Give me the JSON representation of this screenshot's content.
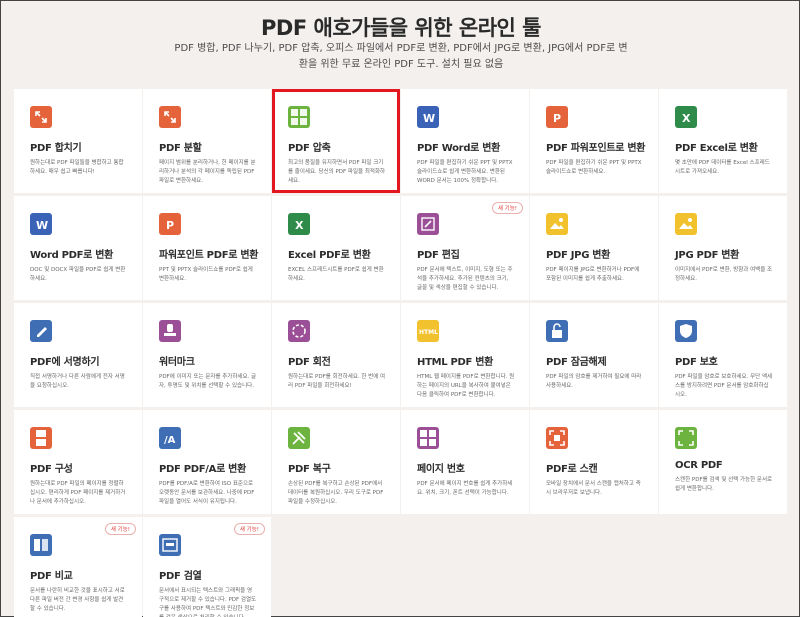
{
  "header": {
    "title": "PDF 애호가들을 위한 온라인 툴",
    "subtitle": "PDF 병합, PDF 나누기, PDF 압축, 오피스 파일에서 PDF로 변환, PDF에서 JPG로 변환, JPG에서 PDF로 변환을 위한 무료 온라인 PDF 도구. 설치 필요 없음"
  },
  "tools": [
    {
      "title": "PDF 합치기",
      "desc": "원하는대로 PDF 파일들을 병합하고 통합하세요. 매우 쉽고 빠릅니다!",
      "icon": "merge-icon",
      "color": "#e5633a",
      "badge": ""
    },
    {
      "title": "PDF 분할",
      "desc": "페이지 범위를 분리하거나, 한 페이지를 분리하거나 분석의 각 페이지를 독립된 PDF 파일로 변환하세요.",
      "icon": "split-icon",
      "color": "#e5633a",
      "badge": ""
    },
    {
      "title": "PDF 압축",
      "desc": "최고의 품질을 유지하면서 PDF 파일 크기를 줄이세요. 당신의 PDF 파일을 최적화하세요.",
      "icon": "compress-icon",
      "color": "#6db33f",
      "badge": ""
    },
    {
      "title": "PDF Word로 변환",
      "desc": "PDF 파일을 편집하기 쉬운 PPT 및 PPTX 슬라이드쇼로 쉽게 변환하세요. 변환된 WORD 문서는 100% 정확합니다.",
      "icon": "word-icon",
      "color": "#3a63b8",
      "badge": ""
    },
    {
      "title": "PDF 파워포인트로 변환",
      "desc": "PDF 파일을 편집하기 쉬운 PPT 및 PPTX 슬라이드쇼로 변환하세요.",
      "icon": "powerpoint-icon",
      "color": "#e5633a",
      "badge": ""
    },
    {
      "title": "PDF Excel로 변환",
      "desc": "몇 초만에 PDF 데이터를 Excel 스프레드 시트로 가져오세요.",
      "icon": "excel-icon",
      "color": "#2e8b4a",
      "badge": ""
    },
    {
      "title": "Word PDF로 변환",
      "desc": "DOC 및 DOCX 파일을 PDF로 쉽게 변환하세요.",
      "icon": "word-icon",
      "color": "#3a63b8",
      "badge": ""
    },
    {
      "title": "파워포인트 PDF로 변환",
      "desc": "PPT 및 PPTX 슬라이드쇼를 PDF로 쉽게 변환하세요.",
      "icon": "powerpoint-icon",
      "color": "#e5633a",
      "badge": ""
    },
    {
      "title": "Excel PDF로 변환",
      "desc": "EXCEL 스프레드시트를 PDF로 쉽게 변환하세요.",
      "icon": "excel-icon",
      "color": "#2e8b4a",
      "badge": ""
    },
    {
      "title": "PDF 편집",
      "desc": "PDF 문서에 텍스트, 이미지, 도형 또는 주석을 추가하세요. 추가된 컨텐츠의 크기, 글꼴 및 색상을 편집할 수 있습니다.",
      "icon": "edit-icon",
      "color": "#9b4f96",
      "badge": "새 기능!"
    },
    {
      "title": "PDF JPG 변환",
      "desc": "PDF 페이지를 JPG로 변환하거나 PDF에 포함된 이미지를 쉽게 추출하세요.",
      "icon": "jpg-icon",
      "color": "#f2c12e",
      "badge": ""
    },
    {
      "title": "JPG PDF 변환",
      "desc": "이미지에서 PDF로 변환, 방향과 여백을 조정하세요.",
      "icon": "jpg-icon",
      "color": "#f2c12e",
      "badge": ""
    },
    {
      "title": "PDF에 서명하기",
      "desc": "직접 서명하거나 다른 사람에게 전자 서명을 요청하십시오.",
      "icon": "sign-icon",
      "color": "#3f6eb5",
      "badge": ""
    },
    {
      "title": "워터마크",
      "desc": "PDF에 이미지 또는 문자를 추가하세요. 글자, 투명도 및 위치를 선택할 수 있습니다.",
      "icon": "stamp-icon",
      "color": "#9b4f96",
      "badge": ""
    },
    {
      "title": "PDF 회전",
      "desc": "원하는대로 PDF를 회전하세요. 한 번에 여러 PDF 파일을 회전하세요!",
      "icon": "rotate-icon",
      "color": "#9b4f96",
      "badge": ""
    },
    {
      "title": "HTML PDF 변환",
      "desc": "HTML 웹 페이지를 PDF로 변환합니다. 원하는 페이지의 URL을 복사하여 붙여넣은 다음 클릭하여 PDF로 변환합니다.",
      "icon": "html-icon",
      "color": "#f2c12e",
      "badge": ""
    },
    {
      "title": "PDF 잠금해제",
      "desc": "PDF 파일의 암호를 제거하여 필요에 따라 사용하세요.",
      "icon": "unlock-icon",
      "color": "#3f6eb5",
      "badge": ""
    },
    {
      "title": "PDF 보호",
      "desc": "PDF 파일을 암호로 보호하세요. 무단 액세스를 방지하려면 PDF 문서를 암호화하십시오.",
      "icon": "protect-icon",
      "color": "#3f6eb5",
      "badge": ""
    },
    {
      "title": "PDF 구성",
      "desc": "원하는대로 PDF 파일의 페이지를 정렬하십시오. 편리하게 PDF 페이지를 제거하거나 문서에 추가하십시오.",
      "icon": "organize-icon",
      "color": "#e5633a",
      "badge": ""
    },
    {
      "title": "PDF PDF/A로 변환",
      "desc": "PDF를 PDF/A로 변환하여 ISO 표준으로 오랫동안 문서를 보관하세요. 나중에 PDF 파일을 열어도 서식이 유지됩니다.",
      "icon": "pdfa-icon",
      "color": "#3f6eb5",
      "badge": ""
    },
    {
      "title": "PDF 복구",
      "desc": "손상된 PDF를 복구하고 손상된 PDF에서 데이터를 복원하십시오. 우리 도구로 PDF 파일을 수정하십시오.",
      "icon": "repair-icon",
      "color": "#6db33f",
      "badge": ""
    },
    {
      "title": "페이지 번호",
      "desc": "PDF 문서에 페이지 번호를 쉽게 추가하세요. 위치, 크기, 폰트 선택이 가능합니다.",
      "icon": "numbers-icon",
      "color": "#9b4f96",
      "badge": ""
    },
    {
      "title": "PDF로 스캔",
      "desc": "모바일 장치에서 문서 스캔을 캡처하고 즉시 브라우저로 보냅니다.",
      "icon": "scan-icon",
      "color": "#e5633a",
      "badge": ""
    },
    {
      "title": "OCR PDF",
      "desc": "스캔한 PDF를 검색 및 선택 가능한 문서로 쉽게 변환합니다.",
      "icon": "ocr-icon",
      "color": "#6db33f",
      "badge": ""
    },
    {
      "title": "PDF 비교",
      "desc": "문서를 나란히 비교한 것을 표시하고 서로 다른 파일 버전 간 변경 사항을 쉽게 발견할 수 있습니다.",
      "icon": "compare-icon",
      "color": "#3f6eb5",
      "badge": "새 기능!"
    },
    {
      "title": "PDF 검열",
      "desc": "문서에서 표시되는 텍스트와 그래픽을 영구적으로 제거할 수 있습니다. PDF 검열도구를 사용하여 PDF 텍스트와 민감한 정보를 검은 색상으로 처리할 수 있습니다.",
      "icon": "redact-icon",
      "color": "#3f6eb5",
      "badge": "새 기능!"
    }
  ]
}
